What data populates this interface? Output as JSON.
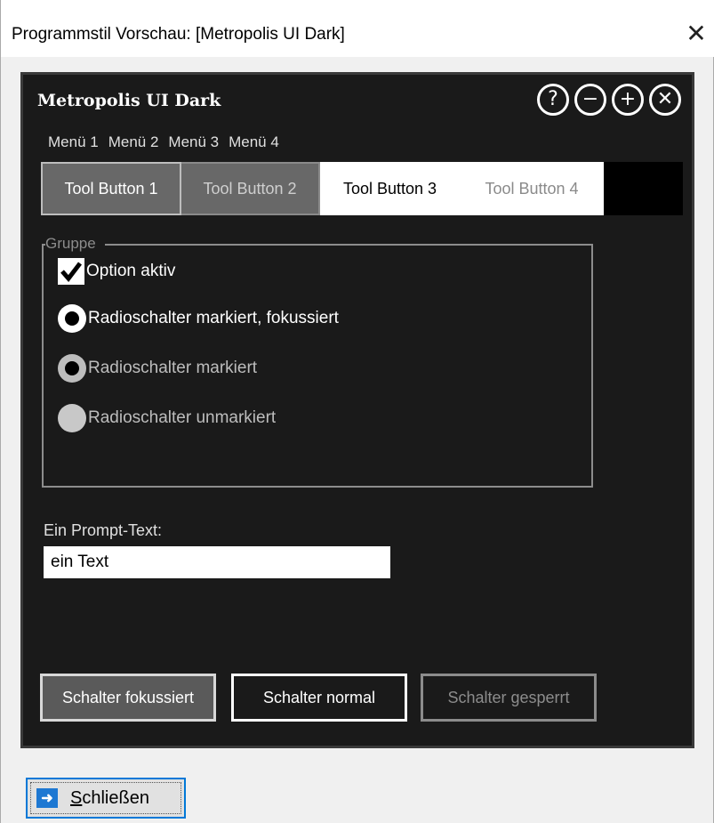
{
  "window": {
    "title": "Programmstil Vorschau: [Metropolis UI Dark]",
    "close_glyph": "✕"
  },
  "preview": {
    "app_title": "Metropolis UI Dark",
    "controls": [
      {
        "name": "help-icon",
        "glyph": "?"
      },
      {
        "name": "minimize-icon",
        "glyph": "−"
      },
      {
        "name": "maximize-icon",
        "glyph": "+"
      },
      {
        "name": "close-icon",
        "glyph": "✕"
      }
    ],
    "menu": [
      "Menü 1",
      "Menü 2",
      "Menü 3",
      "Menü 4"
    ],
    "toolbar": [
      "Tool Button 1",
      "Tool Button 2",
      "Tool Button 3",
      "Tool Button 4"
    ],
    "group": {
      "legend": "Gruppe",
      "checkbox_label": "Option aktiv",
      "radio_focused": "Radioschalter markiert, fokussiert",
      "radio_checked": "Radioschalter markiert",
      "radio_unchecked": "Radioschalter unmarkiert"
    },
    "prompt": {
      "label": "Ein Prompt-Text:",
      "value": "ein Text"
    },
    "buttons": {
      "focused": "Schalter fokussiert",
      "normal": "Schalter normal",
      "disabled": "Schalter gesperrt"
    }
  },
  "footer": {
    "close_first": "S",
    "close_rest": "chließen"
  },
  "colors": {
    "preview_bg": "#1a1a1a",
    "accent": "#0078d7"
  }
}
